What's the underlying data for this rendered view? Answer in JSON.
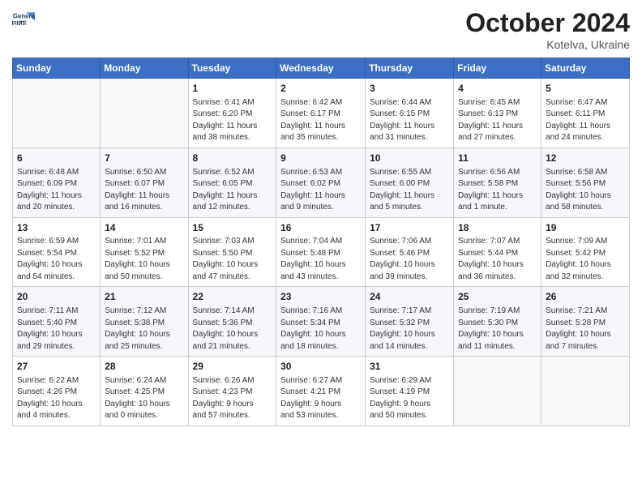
{
  "logo": {
    "line1": "General",
    "line2": "Blue"
  },
  "title": "October 2024",
  "location": "Kotelva, Ukraine",
  "days_header": [
    "Sunday",
    "Monday",
    "Tuesday",
    "Wednesday",
    "Thursday",
    "Friday",
    "Saturday"
  ],
  "weeks": [
    [
      {
        "num": "",
        "info": ""
      },
      {
        "num": "",
        "info": ""
      },
      {
        "num": "1",
        "info": "Sunrise: 6:41 AM\nSunset: 6:20 PM\nDaylight: 11 hours\nand 38 minutes."
      },
      {
        "num": "2",
        "info": "Sunrise: 6:42 AM\nSunset: 6:17 PM\nDaylight: 11 hours\nand 35 minutes."
      },
      {
        "num": "3",
        "info": "Sunrise: 6:44 AM\nSunset: 6:15 PM\nDaylight: 11 hours\nand 31 minutes."
      },
      {
        "num": "4",
        "info": "Sunrise: 6:45 AM\nSunset: 6:13 PM\nDaylight: 11 hours\nand 27 minutes."
      },
      {
        "num": "5",
        "info": "Sunrise: 6:47 AM\nSunset: 6:11 PM\nDaylight: 11 hours\nand 24 minutes."
      }
    ],
    [
      {
        "num": "6",
        "info": "Sunrise: 6:48 AM\nSunset: 6:09 PM\nDaylight: 11 hours\nand 20 minutes."
      },
      {
        "num": "7",
        "info": "Sunrise: 6:50 AM\nSunset: 6:07 PM\nDaylight: 11 hours\nand 16 minutes."
      },
      {
        "num": "8",
        "info": "Sunrise: 6:52 AM\nSunset: 6:05 PM\nDaylight: 11 hours\nand 12 minutes."
      },
      {
        "num": "9",
        "info": "Sunrise: 6:53 AM\nSunset: 6:02 PM\nDaylight: 11 hours\nand 9 minutes."
      },
      {
        "num": "10",
        "info": "Sunrise: 6:55 AM\nSunset: 6:00 PM\nDaylight: 11 hours\nand 5 minutes."
      },
      {
        "num": "11",
        "info": "Sunrise: 6:56 AM\nSunset: 5:58 PM\nDaylight: 11 hours\nand 1 minute."
      },
      {
        "num": "12",
        "info": "Sunrise: 6:58 AM\nSunset: 5:56 PM\nDaylight: 10 hours\nand 58 minutes."
      }
    ],
    [
      {
        "num": "13",
        "info": "Sunrise: 6:59 AM\nSunset: 5:54 PM\nDaylight: 10 hours\nand 54 minutes."
      },
      {
        "num": "14",
        "info": "Sunrise: 7:01 AM\nSunset: 5:52 PM\nDaylight: 10 hours\nand 50 minutes."
      },
      {
        "num": "15",
        "info": "Sunrise: 7:03 AM\nSunset: 5:50 PM\nDaylight: 10 hours\nand 47 minutes."
      },
      {
        "num": "16",
        "info": "Sunrise: 7:04 AM\nSunset: 5:48 PM\nDaylight: 10 hours\nand 43 minutes."
      },
      {
        "num": "17",
        "info": "Sunrise: 7:06 AM\nSunset: 5:46 PM\nDaylight: 10 hours\nand 39 minutes."
      },
      {
        "num": "18",
        "info": "Sunrise: 7:07 AM\nSunset: 5:44 PM\nDaylight: 10 hours\nand 36 minutes."
      },
      {
        "num": "19",
        "info": "Sunrise: 7:09 AM\nSunset: 5:42 PM\nDaylight: 10 hours\nand 32 minutes."
      }
    ],
    [
      {
        "num": "20",
        "info": "Sunrise: 7:11 AM\nSunset: 5:40 PM\nDaylight: 10 hours\nand 29 minutes."
      },
      {
        "num": "21",
        "info": "Sunrise: 7:12 AM\nSunset: 5:38 PM\nDaylight: 10 hours\nand 25 minutes."
      },
      {
        "num": "22",
        "info": "Sunrise: 7:14 AM\nSunset: 5:36 PM\nDaylight: 10 hours\nand 21 minutes."
      },
      {
        "num": "23",
        "info": "Sunrise: 7:16 AM\nSunset: 5:34 PM\nDaylight: 10 hours\nand 18 minutes."
      },
      {
        "num": "24",
        "info": "Sunrise: 7:17 AM\nSunset: 5:32 PM\nDaylight: 10 hours\nand 14 minutes."
      },
      {
        "num": "25",
        "info": "Sunrise: 7:19 AM\nSunset: 5:30 PM\nDaylight: 10 hours\nand 11 minutes."
      },
      {
        "num": "26",
        "info": "Sunrise: 7:21 AM\nSunset: 5:28 PM\nDaylight: 10 hours\nand 7 minutes."
      }
    ],
    [
      {
        "num": "27",
        "info": "Sunrise: 6:22 AM\nSunset: 4:26 PM\nDaylight: 10 hours\nand 4 minutes."
      },
      {
        "num": "28",
        "info": "Sunrise: 6:24 AM\nSunset: 4:25 PM\nDaylight: 10 hours\nand 0 minutes."
      },
      {
        "num": "29",
        "info": "Sunrise: 6:26 AM\nSunset: 4:23 PM\nDaylight: 9 hours\nand 57 minutes."
      },
      {
        "num": "30",
        "info": "Sunrise: 6:27 AM\nSunset: 4:21 PM\nDaylight: 9 hours\nand 53 minutes."
      },
      {
        "num": "31",
        "info": "Sunrise: 6:29 AM\nSunset: 4:19 PM\nDaylight: 9 hours\nand 50 minutes."
      },
      {
        "num": "",
        "info": ""
      },
      {
        "num": "",
        "info": ""
      }
    ]
  ]
}
